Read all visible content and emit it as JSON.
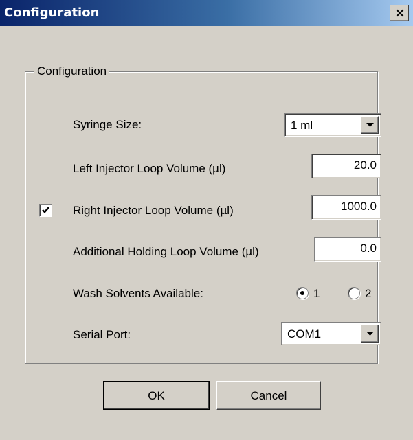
{
  "window": {
    "title": "Configuration"
  },
  "group": {
    "label": "Configuration"
  },
  "fields": {
    "syringe_size": {
      "label": "Syringe Size:",
      "value": "1 ml"
    },
    "left_loop": {
      "label": "Left Injector Loop Volume (µl)",
      "value": "20.0"
    },
    "right_loop": {
      "label": "Right Injector Loop Volume (µl)",
      "value": "1000.0",
      "checked": true
    },
    "holding_loop": {
      "label": "Additional Holding Loop Volume (µl)",
      "value": "0.0"
    },
    "wash_solvents": {
      "label": "Wash Solvents Available:",
      "options": [
        "1",
        "2"
      ],
      "selected": "1"
    },
    "serial_port": {
      "label": "Serial Port:",
      "value": "COM1"
    }
  },
  "buttons": {
    "ok": "OK",
    "cancel": "Cancel"
  },
  "icons": {
    "close": "close-icon",
    "dropdown": "chevron-down-icon",
    "check": "check-icon"
  },
  "colors": {
    "titlebar_start": "#0a246a",
    "titlebar_end": "#a6caf0",
    "face": "#d4d0c8"
  }
}
